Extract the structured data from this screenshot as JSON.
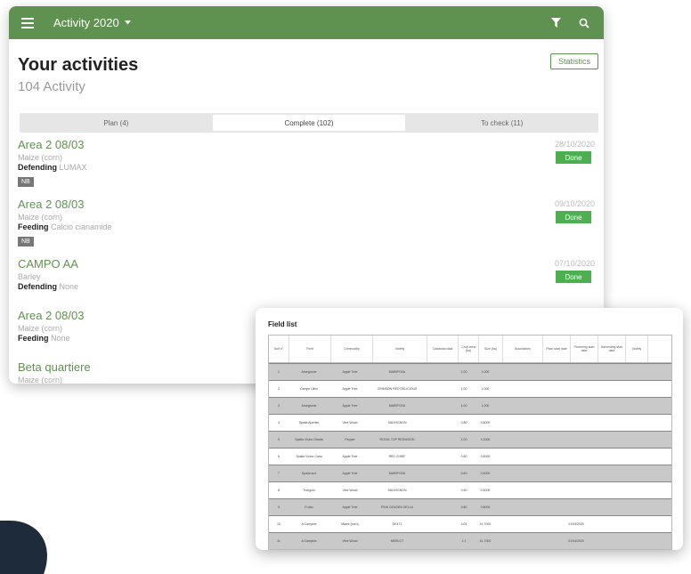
{
  "appbar": {
    "title": "Activity 2020",
    "menu_icon": "hamburger-icon",
    "filter_icon": "filter-icon",
    "search_icon": "search-icon",
    "color": "#5f9150"
  },
  "header": {
    "title": "Your activities",
    "count": "104 Activity",
    "stats_button": "Statistics"
  },
  "tabs": [
    {
      "label": "Plan (4)",
      "active": false
    },
    {
      "label": "Complete (102)",
      "active": true
    },
    {
      "label": "To check (11)",
      "active": false
    }
  ],
  "activities": [
    {
      "name": "Area 2 08/03",
      "crop": "Maize (corn)",
      "type": "Defending",
      "product": "LUMAX",
      "badge": "NB",
      "date": "28/10/2020",
      "status": "Done"
    },
    {
      "name": "Area 2 08/03",
      "crop": "Maize (corn)",
      "type": "Feeding",
      "product": "Calcio cianamide",
      "badge": "NB",
      "date": "09/10/2020",
      "status": "Done"
    },
    {
      "name": "CAMPO AA",
      "crop": "Barley",
      "type": "Defending",
      "product": "None",
      "date": "07/10/2020",
      "status": "Done"
    },
    {
      "name": "Area 2 08/03",
      "crop": "Maize (corn)",
      "type": "Feeding",
      "product": "None"
    },
    {
      "name": "Beta quartiere",
      "crop": "Maize (corn)"
    }
  ],
  "field_list": {
    "title": "Field list",
    "columns": [
      "Unit n°",
      "Field",
      "Commodity",
      "Variety",
      "Cadastral data",
      "Crop area (ha)",
      "Size (ha)",
      "Boundaries",
      "Plant start date",
      "Flowering start date",
      "Harvesting start date",
      "Variety"
    ],
    "rows": [
      [
        "1",
        "Arsegnone",
        "Apple Tree",
        "MARIPOSA",
        "",
        "1.00",
        "1.000"
      ],
      [
        "2",
        "Campo Ulivo",
        "Apple Tree",
        "CRIMSON RED DELICIOUS",
        "",
        "1.00",
        "1.000"
      ],
      [
        "3",
        "Arsegnone",
        "Apple Tree",
        "MARIPOSA",
        "",
        "1.00",
        "1.000"
      ],
      [
        "4",
        "Spalla Apertim",
        "Vine Wood",
        "SAUVIGNON",
        "",
        "0.80",
        "0.8000"
      ],
      [
        "5",
        "Spalla Vicino Strada",
        "Pepper",
        "ROYAL TOP REDWOOD",
        "",
        "1.00",
        "1.0000"
      ],
      [
        "6",
        "Spalla Vicino Casa",
        "Apple Tree",
        "RED CHIEF",
        "",
        "0.80",
        "0.8000"
      ],
      [
        "7",
        "Spalla sud",
        "Apple Tree",
        "MARIPOSA",
        "",
        "0.60",
        "0.6000"
      ],
      [
        "8",
        "Trongolo",
        "Vine Wood",
        "SAUVIGNON",
        "",
        "0.50",
        "0.5000"
      ],
      [
        "9",
        "Frutto",
        "Apple Tree",
        "PINK GOLDEN DELLA",
        "",
        "0.80",
        "0.8000"
      ],
      [
        "10",
        "A Campine",
        "Maize (corn)",
        "DK471",
        "",
        "4.01",
        "41.7000",
        "",
        "",
        "01/04/2020"
      ],
      [
        "11",
        "A Campine",
        "Vine Wood",
        "MERLOT",
        "",
        "1.1",
        "41.7000",
        "",
        "",
        "01/04/2020"
      ]
    ]
  }
}
